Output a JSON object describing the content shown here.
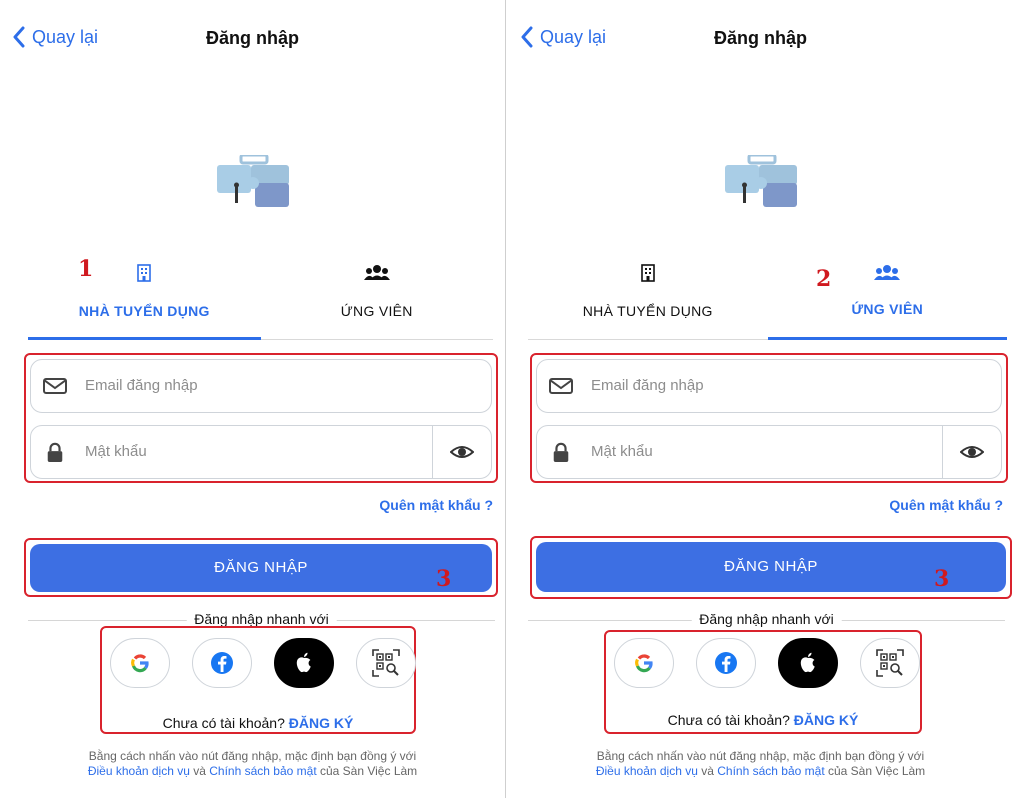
{
  "colors": {
    "accent": "#2d6ee9",
    "button": "#3d6fe3",
    "annotation": "#d9232d"
  },
  "panels": [
    {
      "header": {
        "back_label": "Quay lại",
        "title": "Đăng nhập"
      },
      "tabs": [
        {
          "label": "NHÀ TUYỂN DỤNG",
          "icon": "building-icon",
          "active": true
        },
        {
          "label": "ỨNG VIÊN",
          "icon": "users-icon",
          "active": false
        }
      ],
      "annotation_tab": "1",
      "annotation_button": "3",
      "form": {
        "email_placeholder": "Email đăng nhập",
        "password_placeholder": "Mật khẩu"
      },
      "forgot_label": "Quên mật khẩu ?",
      "login_label": "ĐĂNG NHẬP",
      "quick_login_label": "Đăng nhập nhanh với",
      "social": [
        "google-icon",
        "facebook-icon",
        "apple-icon",
        "qr-scan-icon"
      ],
      "signup": {
        "prompt": "Chưa có tài khoản?",
        "link": "ĐĂNG KÝ"
      },
      "terms": {
        "line1": "Bằng cách nhấn vào nút đăng nhập, mặc định bạn đồng ý với",
        "link1": "Điều khoản dịch vụ",
        "and": " và ",
        "link2": "Chính sách bảo mật",
        "suffix": " của Sàn Việc Làm"
      }
    },
    {
      "header": {
        "back_label": "Quay lại",
        "title": "Đăng nhập"
      },
      "tabs": [
        {
          "label": "NHÀ TUYỂN DỤNG",
          "icon": "building-icon",
          "active": false
        },
        {
          "label": "ỨNG VIÊN",
          "icon": "users-icon",
          "active": true
        }
      ],
      "annotation_tab": "2",
      "annotation_button": "3",
      "form": {
        "email_placeholder": "Email đăng nhập",
        "password_placeholder": "Mật khẩu"
      },
      "forgot_label": "Quên mật khẩu ?",
      "login_label": "ĐĂNG NHẬP",
      "quick_login_label": "Đăng nhập nhanh với",
      "social": [
        "google-icon",
        "facebook-icon",
        "apple-icon",
        "qr-scan-icon"
      ],
      "signup": {
        "prompt": "Chưa có tài khoản?",
        "link": "ĐĂNG KÝ"
      },
      "terms": {
        "line1": "Bằng cách nhấn vào nút đăng nhập, mặc định bạn đồng ý với",
        "link1": "Điều khoản dịch vụ",
        "and": " và ",
        "link2": "Chính sách bảo mật",
        "suffix": " của Sàn Việc Làm"
      }
    }
  ]
}
